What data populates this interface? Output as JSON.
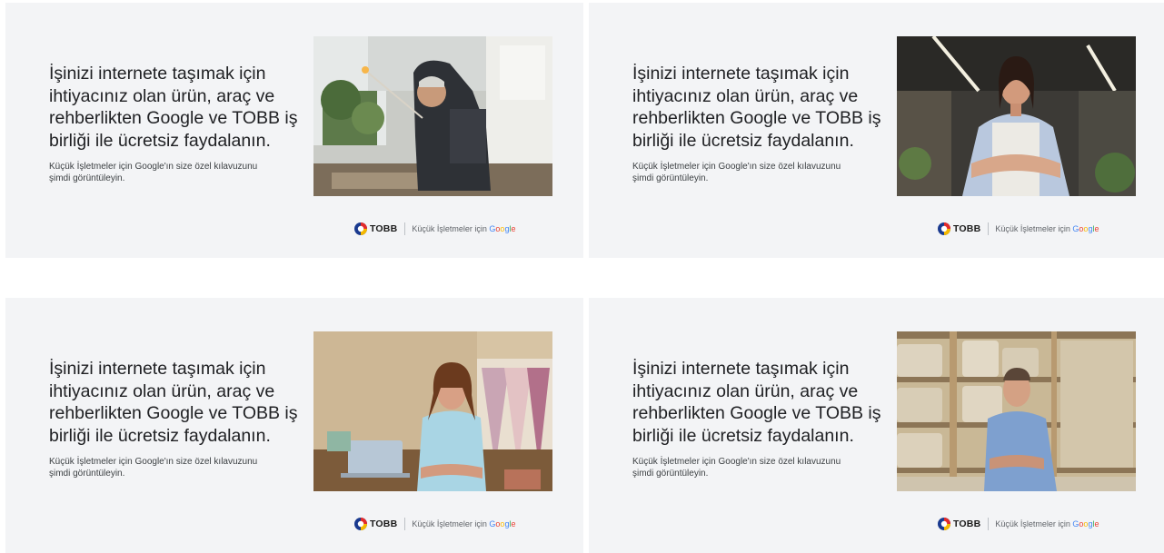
{
  "cards": [
    {
      "headline": "İşinizi internete taşımak için ihtiyacınız olan ürün, araç ve rehberlikten Google ve TOBB iş birliği ile ücretsiz faydalanın.",
      "subtext": "Küçük İşletmeler için Google'ın size özel kılavuzunu şimdi görüntüleyin.",
      "photo_subject": "glassblower-photo"
    },
    {
      "headline": "İşinizi internete taşımak için ihtiyacınız olan ürün, araç ve rehberlikten Google ve TOBB iş birliği ile ücretsiz faydalanın.",
      "subtext": "Küçük İşletmeler için Google'ın size özel kılavuzunu şimdi görüntüleyin.",
      "photo_subject": "shop-owner-photo"
    },
    {
      "headline": "İşinizi internete taşımak için ihtiyacınız olan ürün, araç ve rehberlikten Google ve TOBB iş birliği ile ücretsiz faydalanın.",
      "subtext": "Küçük İşletmeler için Google'ın size özel kılavuzunu şimdi görüntüleyin.",
      "photo_subject": "boutique-owner-photo"
    },
    {
      "headline": "İşinizi internete taşımak için ihtiyacınız olan ürün, araç ve rehberlikten Google ve TOBB iş birliği ile ücretsiz faydalanın.",
      "subtext": "Küçük İşletmeler için Google'ın size özel kılavuzunu şimdi görüntüleyin.",
      "photo_subject": "cheese-maker-photo"
    }
  ],
  "brand": {
    "tobb": "TOBB",
    "prefix": "Küçük İşletmeler için ",
    "google_letters": [
      "G",
      "o",
      "o",
      "g",
      "l",
      "e"
    ]
  },
  "colors": {
    "card_bg": "#f3f4f6",
    "headline": "#202124",
    "google_blue": "#4285f4",
    "google_red": "#ea4335",
    "google_yellow": "#fbbc05",
    "google_green": "#34a853"
  }
}
